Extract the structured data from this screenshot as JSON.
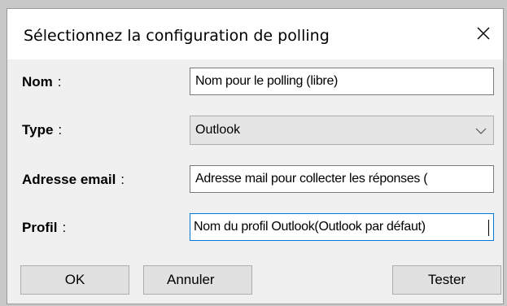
{
  "dialog": {
    "title": "Sélectionnez la configuration de polling",
    "close_icon": "close-icon"
  },
  "fields": {
    "nom": {
      "label": "Nom",
      "colon": ":",
      "value": "Nom pour le polling (libre)"
    },
    "type": {
      "label": "Type",
      "colon": ":",
      "value": "Outlook"
    },
    "email": {
      "label": "Adresse email",
      "colon": ":",
      "value": "Adresse mail pour collecter les réponses ("
    },
    "profil": {
      "label": "Profil",
      "colon": ":",
      "value": "Nom du profil Outlook(Outlook par défaut)"
    }
  },
  "buttons": {
    "ok": "OK",
    "cancel": "Annuler",
    "test": "Tester"
  },
  "colors": {
    "focus_border": "#0078d7",
    "dialog_bg": "#f0f0f0"
  }
}
